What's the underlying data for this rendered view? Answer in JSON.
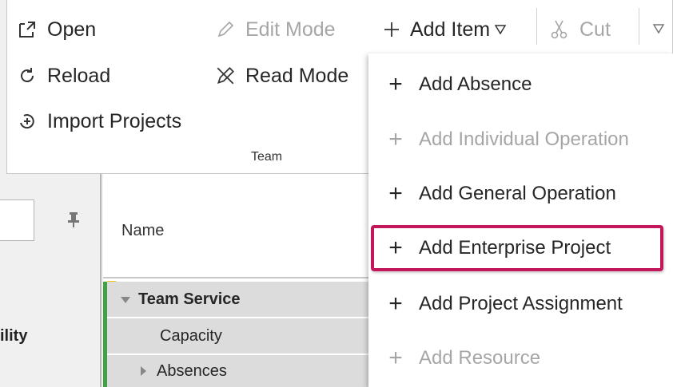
{
  "ribbon": {
    "open": "Open",
    "reload": "Reload",
    "import_projects": "Import Projects",
    "edit_mode": "Edit Mode",
    "read_mode": "Read Mode",
    "add_item": "Add Item",
    "cut": "Cut",
    "group_label": "Team"
  },
  "left_pane": {
    "partial_label": "ility"
  },
  "grid": {
    "column_name": "Name",
    "rows": [
      {
        "label": "Team Service",
        "expanded": true
      },
      {
        "label": "Capacity"
      },
      {
        "label": "Absences",
        "expanded": false
      }
    ]
  },
  "menu": {
    "items": [
      {
        "label": "Add Absence",
        "enabled": true
      },
      {
        "label": "Add Individual Operation",
        "enabled": false
      },
      {
        "label": "Add General Operation",
        "enabled": true
      },
      {
        "label": "Add Enterprise Project",
        "enabled": true,
        "highlighted": true
      },
      {
        "label": "Add Project Assignment",
        "enabled": true
      },
      {
        "label": "Add Resource",
        "enabled": false
      }
    ]
  },
  "colors": {
    "highlight_border": "#c2185b",
    "tree_accent": "#43a047",
    "disabled_text": "#a6a6a6"
  }
}
